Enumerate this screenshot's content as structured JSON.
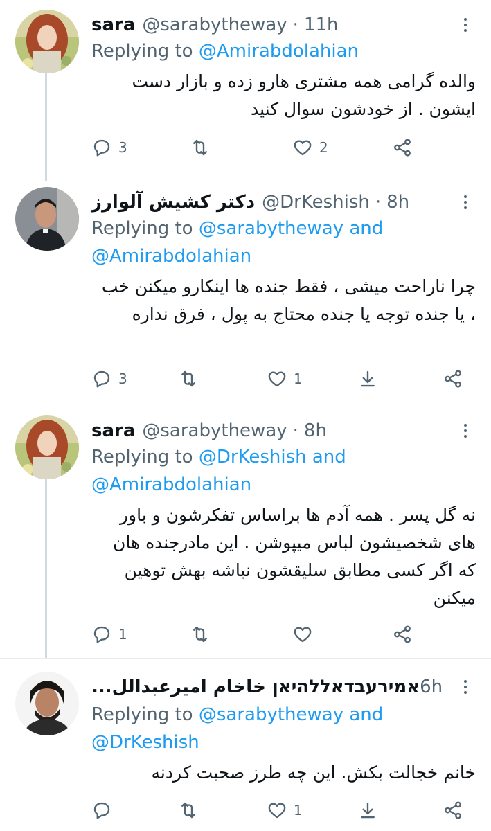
{
  "tweets": [
    {
      "name": "sara",
      "handle": "@sarabytheway",
      "time": "11h",
      "replying_prefix": "Replying to",
      "replying_to": [
        "@Amirabdolahian"
      ],
      "replying_joiner": "",
      "text": "والده گرامی همه مشتری هارو زده و بازار دست ایشون . از خودشون سوال کنید",
      "replies": "3",
      "retweets": "",
      "likes": "2"
    },
    {
      "name": "دکتر کشیش آلوارز",
      "handle": "@DrKeshish",
      "time": "8h",
      "replying_prefix": "Replying to",
      "replying_to": [
        "@sarabytheway",
        "@Amirabdolahian"
      ],
      "replying_joiner": "and",
      "text": "چرا ناراحت میشی ، فقط جنده ها اینکارو میکنن خب ، یا جنده توجه یا جنده محتاج به پول ، فرق نداره",
      "replies": "3",
      "retweets": "",
      "likes": "1"
    },
    {
      "name": "sara",
      "handle": "@sarabytheway",
      "time": "8h",
      "replying_prefix": "Replying to",
      "replying_to": [
        "@DrKeshish",
        "@Amirabdolahian"
      ],
      "replying_joiner": "and",
      "text": "نه گل پسر . همه آدم ها براساس تفکرشون و باور های شخصیشون لباس میپوشن . این مادرجنده هان که اگر کسی مطابق سلیقشون نباشه بهش توهین میکنن",
      "replies": "1",
      "retweets": "",
      "likes": ""
    },
    {
      "name": "אמירעבדאללהיאן خاخام امیرعبدالل...",
      "handle": "",
      "time": "6h",
      "replying_prefix": "Replying to",
      "replying_to": [
        "@sarabytheway",
        "@DrKeshish"
      ],
      "replying_joiner": "and",
      "text": "خانم خجالت بکش. این چه طرز صحبت کردنه",
      "replies": "",
      "retweets": "",
      "likes": "1"
    }
  ],
  "ui": {
    "dot": "·"
  },
  "icons": [
    "reply-icon",
    "retweet-icon",
    "like-icon",
    "share-icon",
    "download-icon",
    "more-icon"
  ],
  "colors": {
    "link": "#1d9bf0",
    "muted": "#536471",
    "text": "#0f1419",
    "thread_line": "#cfd9de"
  }
}
